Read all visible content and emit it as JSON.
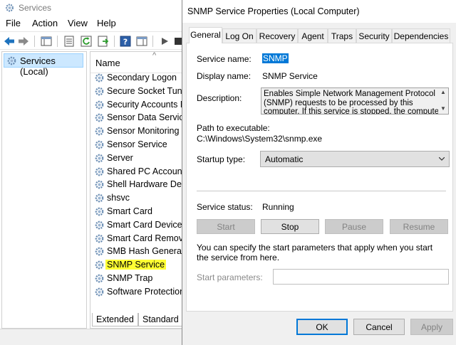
{
  "services_window": {
    "title": "Services",
    "menu": [
      "File",
      "Action",
      "View",
      "Help"
    ],
    "tree_root": "Services (Local)",
    "column_header": "Name",
    "services": [
      "Secondary Logon",
      "Secure Socket Tunn",
      "Security Accounts M",
      "Sensor Data Service",
      "Sensor Monitoring S",
      "Sensor Service",
      "Server",
      "Shared PC Account",
      "Shell Hardware Dete",
      "shsvc",
      "Smart Card",
      "Smart Card Device E",
      "Smart Card Remova",
      "SMB Hash Generatic",
      "SNMP Service",
      "SNMP Trap",
      "Software Protection"
    ],
    "selected_service": "SNMP Service",
    "tabs": [
      "Extended",
      "Standard"
    ],
    "highlight_color": "#ffff33"
  },
  "dialog": {
    "title": "SNMP Service Properties (Local Computer)",
    "tabs": [
      "General",
      "Log On",
      "Recovery",
      "Agent",
      "Traps",
      "Security",
      "Dependencies"
    ],
    "active_tab": "General",
    "service_name_label": "Service name:",
    "service_name": "SNMP",
    "display_name_label": "Display name:",
    "display_name": "SNMP Service",
    "description_label": "Description:",
    "description": "Enables Simple Network Management Protocol (SNMP) requests to be processed by this computer. If this service is stopped, the computer will be unable",
    "path_label": "Path to executable:",
    "path": "C:\\Windows\\System32\\snmp.exe",
    "startup_type_label": "Startup type:",
    "startup_type": "Automatic",
    "service_status_label": "Service status:",
    "service_status": "Running",
    "buttons": {
      "start": "Start",
      "stop": "Stop",
      "pause": "Pause",
      "resume": "Resume"
    },
    "start_params_hint": "You can specify the start parameters that apply when you start the service from here.",
    "start_params_label": "Start parameters:",
    "start_params_value": "",
    "footer": {
      "ok": "OK",
      "cancel": "Cancel",
      "apply": "Apply"
    },
    "accent_color": "#0078d7"
  }
}
